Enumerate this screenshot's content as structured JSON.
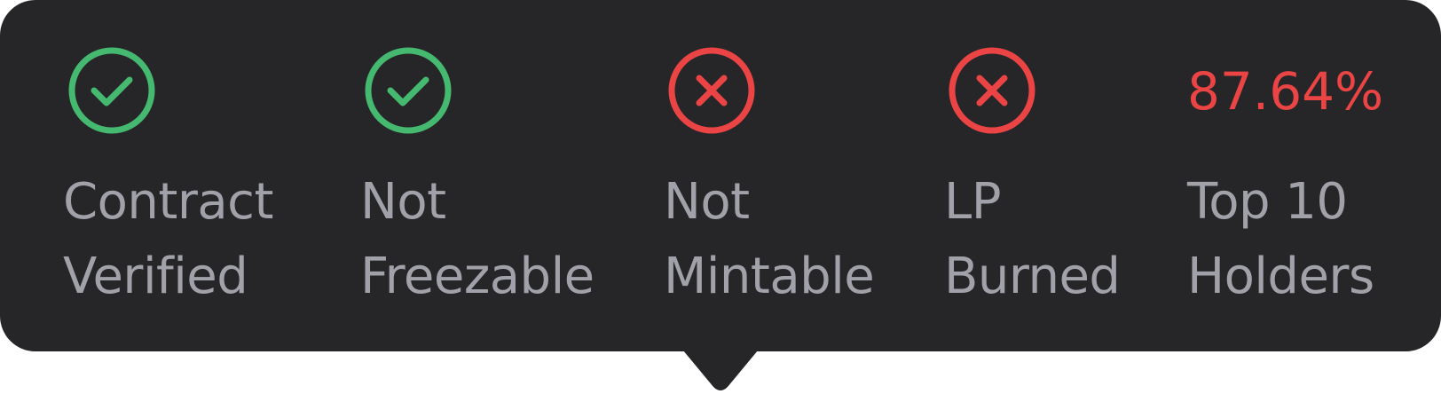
{
  "colors": {
    "background": "#262629",
    "pass": "#45b970",
    "fail": "#ea4444",
    "label": "#a1a1aa"
  },
  "checks": [
    {
      "status": "pass",
      "icon": "check-circle-icon",
      "line1": "Contract",
      "line2": "Verified"
    },
    {
      "status": "pass",
      "icon": "check-circle-icon",
      "line1": "Not",
      "line2": "Freezable"
    },
    {
      "status": "fail",
      "icon": "x-circle-icon",
      "line1": "Not",
      "line2": "Mintable"
    },
    {
      "status": "fail",
      "icon": "x-circle-icon",
      "line1": "LP",
      "line2": "Burned"
    },
    {
      "status": "fail",
      "value": "87.64%",
      "line1": "Top 10",
      "line2": "Holders"
    }
  ]
}
